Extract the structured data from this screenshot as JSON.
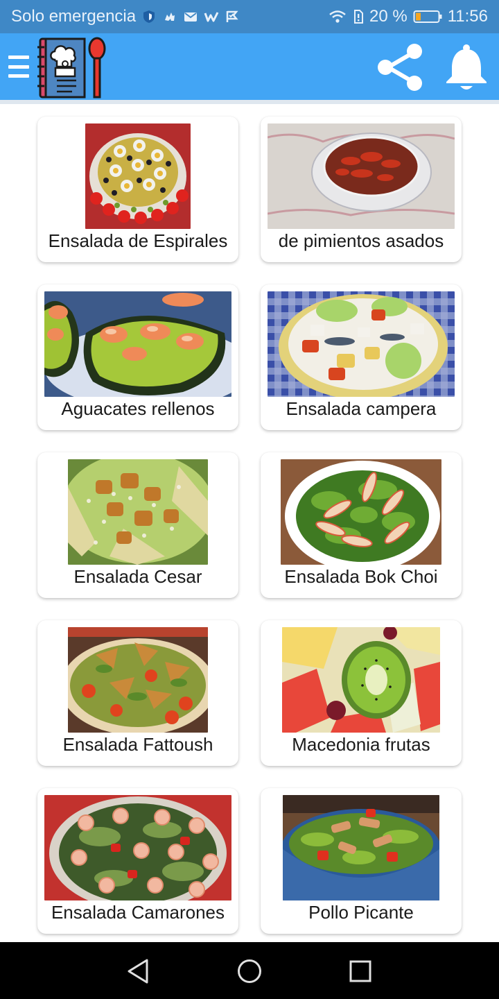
{
  "status": {
    "carrier": "Solo emergencia",
    "battery": "20 %",
    "time": "11:56",
    "icons": [
      "shield-icon",
      "app-notification-icon",
      "mail-icon",
      "w-app-icon",
      "check-flag-icon",
      "wifi-icon",
      "sim-icon",
      "battery-icon"
    ]
  },
  "appbar": {
    "menu_icon": "hamburger-menu-icon",
    "logo_icon": "recipe-book-chef-logo",
    "share_icon": "share-icon",
    "bell_icon": "notification-bell-icon",
    "color": "#42a5f5"
  },
  "recipes": [
    {
      "title": "Ensalada de Espirales",
      "image": "spiral-pasta-salad-photo"
    },
    {
      "title": "de pimientos asados",
      "image": "roasted-peppers-bowl-photo"
    },
    {
      "title": "Aguacates rellenos",
      "image": "stuffed-avocados-photo"
    },
    {
      "title": "Ensalada campera",
      "image": "country-salad-photo"
    },
    {
      "title": "Ensalada Cesar",
      "image": "caesar-salad-photo"
    },
    {
      "title": "Ensalada Bok Choi",
      "image": "bok-choy-salad-photo"
    },
    {
      "title": "Ensalada Fattoush",
      "image": "fattoush-salad-photo"
    },
    {
      "title": "Macedonia frutas",
      "image": "fruit-salad-photo"
    },
    {
      "title": "Ensalada Camarones",
      "image": "shrimp-salad-photo"
    },
    {
      "title": "Pollo Picante",
      "image": "spicy-chicken-salad-photo"
    }
  ],
  "navbar": {
    "back_icon": "back-triangle-icon",
    "home_icon": "home-circle-icon",
    "recents_icon": "recents-square-icon"
  }
}
